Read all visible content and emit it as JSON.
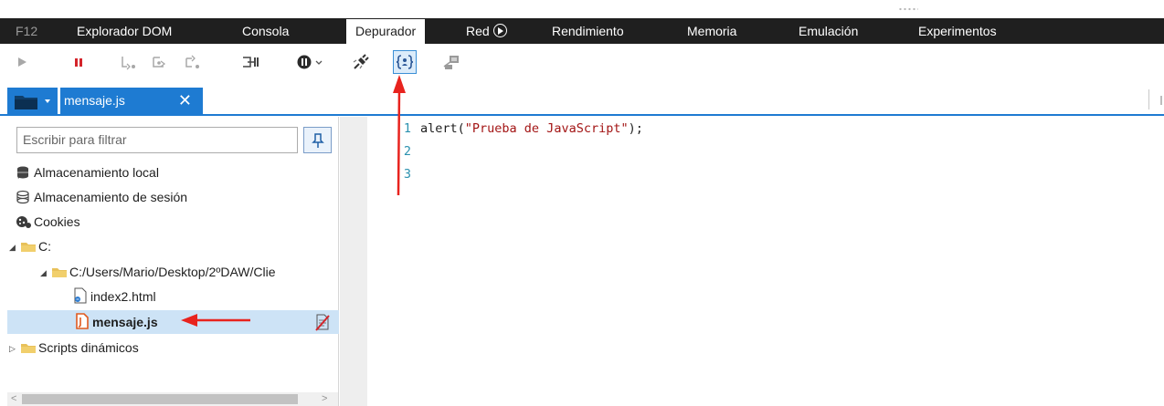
{
  "tabs": [
    {
      "label": "F12"
    },
    {
      "label": "Explorador DOM"
    },
    {
      "label": "Consola"
    },
    {
      "label": "Depurador"
    },
    {
      "label": "Red"
    },
    {
      "label": "Rendimiento"
    },
    {
      "label": "Memoria"
    },
    {
      "label": "Emulación"
    },
    {
      "label": "Experimentos"
    }
  ],
  "active_tab": "Depurador",
  "file_tab": {
    "label": "mensaje.js",
    "close": "✕"
  },
  "filter": {
    "placeholder": "Escribir para filtrar"
  },
  "tree": [
    {
      "label": "Almacenamiento local",
      "icon": "local-storage-icon"
    },
    {
      "label": "Almacenamiento de sesión",
      "icon": "session-storage-icon"
    },
    {
      "label": "Cookies",
      "icon": "cookies-icon"
    },
    {
      "label": "C:",
      "icon": "folder-icon",
      "expander": "◢"
    },
    {
      "label": "C:/Users/Mario/Desktop/2ºDAW/Clie",
      "icon": "folder-icon",
      "expander": "◢"
    },
    {
      "label": "index2.html",
      "icon": "html-file-icon"
    },
    {
      "label": "mensaje.js",
      "icon": "js-file-icon",
      "selected": true
    },
    {
      "label": "Scripts dinámicos",
      "icon": "folder-icon",
      "expander": "▷"
    }
  ],
  "code": {
    "line_numbers": [
      "1",
      "2",
      "3"
    ],
    "line1_prefix": "alert(",
    "line1_string": "\"Prueba de JavaScript\"",
    "line1_suffix": ");"
  },
  "scroll": {
    "left": "<",
    "right": ">"
  },
  "colors": {
    "accent": "#1e7bd2",
    "tabbar_bg": "#1f1f1f",
    "pause": "#d4242b",
    "annotation_arrow": "#e8231e",
    "string": "#a31515",
    "line_number": "#2b91af"
  }
}
